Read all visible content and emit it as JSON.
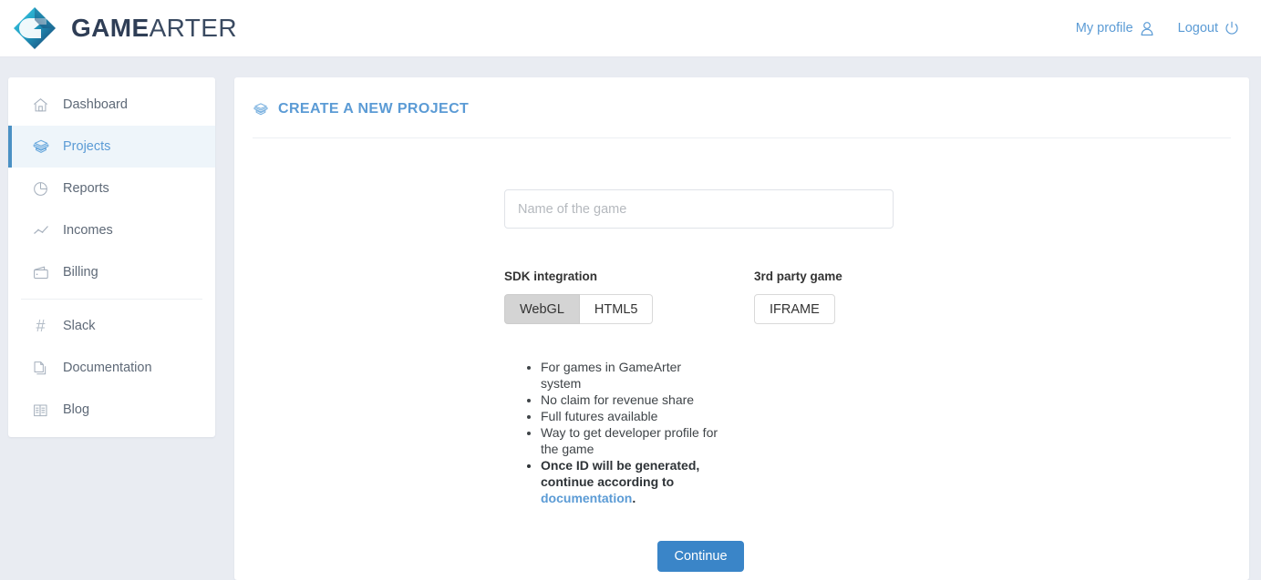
{
  "header": {
    "brand_bold": "GAME",
    "brand_light": "ARTER",
    "logo_icon": "gamearter-diamond-logo",
    "profile_label": "My profile",
    "profile_icon": "user-icon",
    "logout_label": "Logout",
    "logout_icon": "power-icon",
    "link_color": "#5b9bd5"
  },
  "sidebar": {
    "items": [
      {
        "label": "Dashboard",
        "icon": "home-icon",
        "active": false
      },
      {
        "label": "Projects",
        "icon": "box-icon",
        "active": true
      },
      {
        "label": "Reports",
        "icon": "pie-chart-icon",
        "active": false
      },
      {
        "label": "Incomes",
        "icon": "line-chart-icon",
        "active": false
      },
      {
        "label": "Billing",
        "icon": "wallet-icon",
        "active": false
      },
      {
        "label": "Slack",
        "icon": "hash-icon",
        "active": false
      },
      {
        "label": "Documentation",
        "icon": "documents-icon",
        "active": false
      },
      {
        "label": "Blog",
        "icon": "open-book-icon",
        "active": false
      }
    ],
    "active_color": "#5b9bd5",
    "active_bg": "#eef5fa"
  },
  "main": {
    "panel_title": "CREATE A NEW PROJECT",
    "panel_title_icon": "box-icon",
    "name_input": {
      "placeholder": "Name of the game",
      "value": ""
    },
    "sdk_group": {
      "label": "SDK integration",
      "options": [
        {
          "label": "WebGL",
          "selected": true
        },
        {
          "label": "HTML5",
          "selected": false
        }
      ]
    },
    "third_party_group": {
      "label": "3rd party game",
      "options": [
        {
          "label": "IFRAME",
          "selected": false
        }
      ]
    },
    "bullets": [
      {
        "text": "For games in GameArter system",
        "bold": false
      },
      {
        "text": "No claim for revenue share",
        "bold": false
      },
      {
        "text": "Full futures available",
        "bold": false
      },
      {
        "text": "Way to get developer profile for the game",
        "bold": false
      }
    ],
    "bullet_last": {
      "text": "Once ID will be generated, continue according to ",
      "link": "documentation",
      "tail": ".",
      "bold": true
    },
    "continue_label": "Continue",
    "continue_color": "#3a85c8"
  }
}
